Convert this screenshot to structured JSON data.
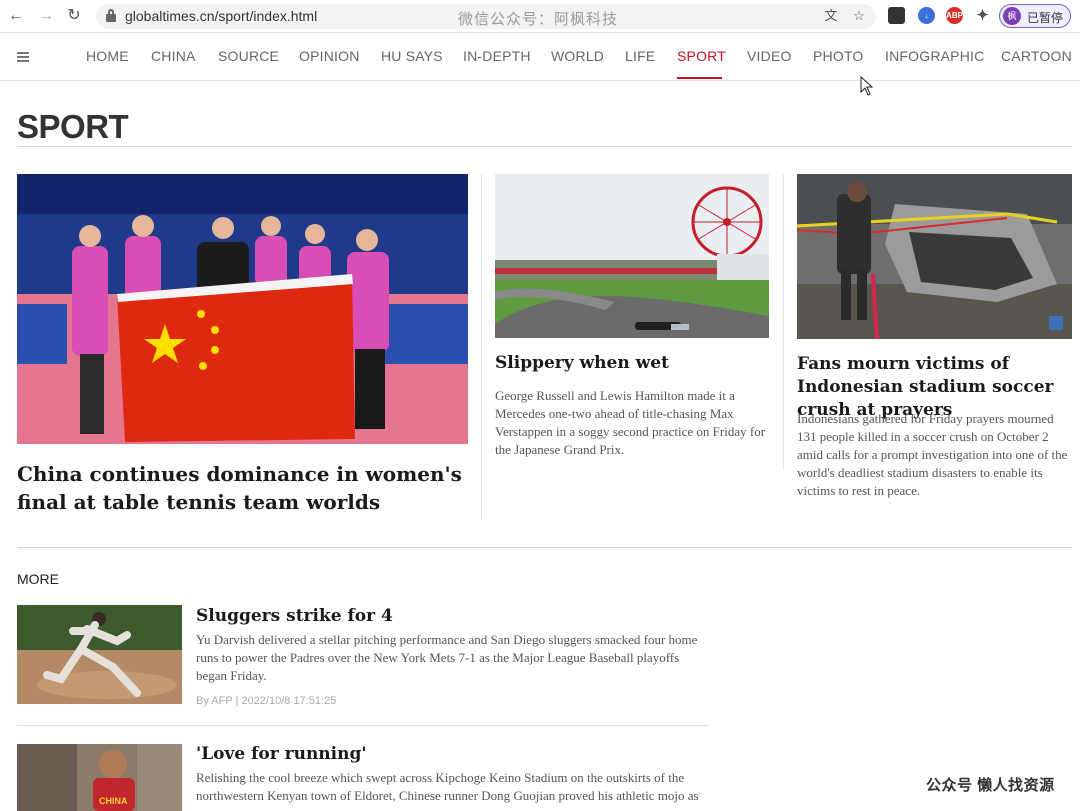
{
  "browser": {
    "url": "globaltimes.cn/sport/index.html",
    "watermark": "微信公众号：阿枫科技",
    "profile_label": "已暂停",
    "profile_initial": "枫",
    "ext_abp": "ABP"
  },
  "nav": {
    "items": [
      "HOME",
      "CHINA",
      "SOURCE",
      "OPINION",
      "HU SAYS",
      "IN-DEPTH",
      "WORLD",
      "LIFE",
      "SPORT",
      "VIDEO",
      "PHOTO",
      "INFOGRAPHIC",
      "CARTOON"
    ],
    "active": "SPORT"
  },
  "page": {
    "title": "SPORT"
  },
  "featured": [
    {
      "headline": "China continues dominance in women's final at table tennis team worlds",
      "summary": ""
    },
    {
      "headline": "Slippery when wet",
      "summary": "George Russell and Lewis Hamilton made it a Mercedes one-two ahead of title-chasing Max Verstappen in a soggy second practice on Friday for the Japanese Grand Prix."
    },
    {
      "headline": "Fans mourn victims of Indonesian stadium soccer crush at prayers",
      "summary": "Indonesians gathered for Friday prayers mourned 131 people killed in a soccer crush on October 2 amid calls for a prompt investigation into one of the world's deadliest stadium disasters to enable its victims to rest in peace."
    }
  ],
  "more": {
    "label": "MORE",
    "items": [
      {
        "headline": "Sluggers strike for 4",
        "summary": "Yu Darvish delivered a stellar pitching performance and San Diego sluggers smacked four home runs to power the Padres over the New York Mets 7-1 as the Major League Baseball playoffs began Friday.",
        "byline": "By AFP | 2022/10/8 17:51:25"
      },
      {
        "headline": "'Love for running'",
        "summary": "Relishing the cool breeze which swept across Kipchoge Keino Stadium on the outskirts of the northwestern Kenyan town of Eldoret, Chinese runner Dong Guojian proved his athletic mojo as",
        "byline": ""
      }
    ]
  },
  "watermark_bottom": "公众号 懒人找资源",
  "colors": {
    "accent": "#c8102e",
    "china_flag": "#de2910",
    "flag_star": "#ffde00"
  }
}
